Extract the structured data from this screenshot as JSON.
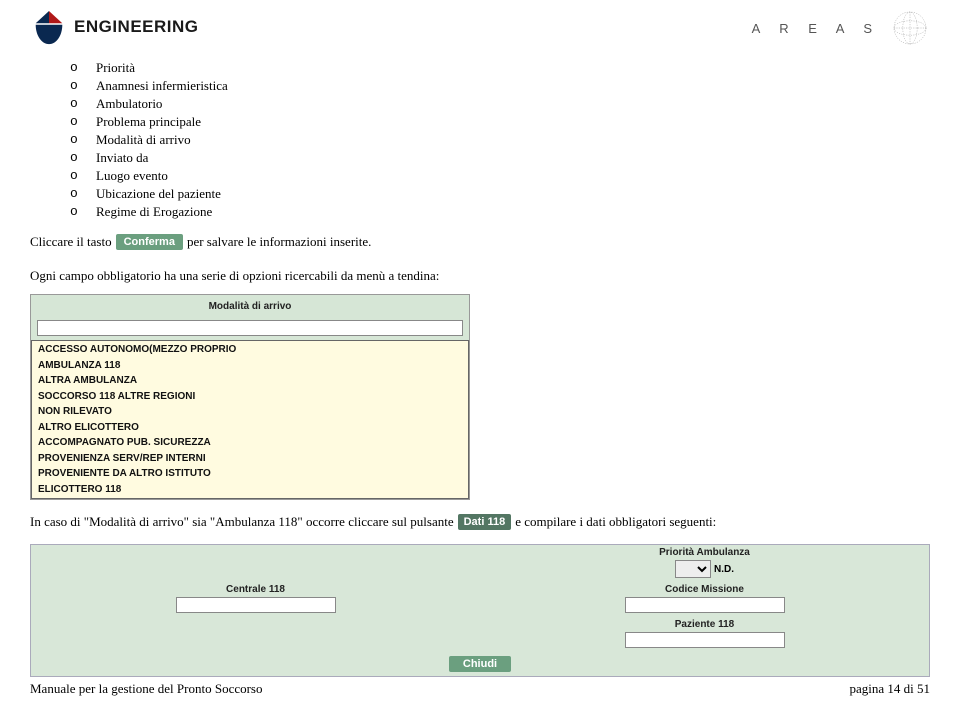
{
  "header": {
    "engineering_text": "ENGINEERING",
    "areas_text": "A R E A S"
  },
  "bullets": {
    "items": [
      "Priorità",
      "Anamnesi infermieristica",
      "Ambulatorio",
      "Problema principale",
      "Modalità di arrivo",
      "Inviato da",
      "Luogo evento",
      "Ubicazione del paziente",
      "Regime di Erogazione"
    ]
  },
  "line1_pre": "Cliccare il tasto",
  "conferma": "Conferma",
  "line1_post": "per salvare le informazioni inserite.",
  "line2": "Ogni campo obbligatorio ha una serie di opzioni ricercabili da menù a tendina:",
  "dropdown": {
    "title": "Modalità di arrivo",
    "options": [
      "ACCESSO AUTONOMO(MEZZO PROPRIO",
      "AMBULANZA 118",
      "ALTRA AMBULANZA",
      "SOCCORSO 118 ALTRE REGIONI",
      "NON RILEVATO",
      "ALTRO ELICOTTERO",
      "ACCOMPAGNATO PUB. SICUREZZA",
      "PROVENIENZA SERV/REP INTERNI",
      "PROVENIENTE DA ALTRO ISTITUTO",
      "ELICOTTERO 118"
    ]
  },
  "line3_pre": "In caso di \"Modalità di arrivo\" sia \"Ambulanza 118\" occorre cliccare sul pulsante",
  "dati118": "Dati 118",
  "line3_post": "e compilare i dati obbligatori seguenti:",
  "form": {
    "priorita_label": "Priorità Ambulanza",
    "nd": "N.D.",
    "centrale_label": "Centrale 118",
    "codice_label": "Codice Missione",
    "paziente_label": "Paziente 118",
    "chiudi": "Chiudi"
  },
  "footer": {
    "left": "Manuale per la gestione del Pronto Soccorso",
    "right": "pagina 14 di 51"
  }
}
